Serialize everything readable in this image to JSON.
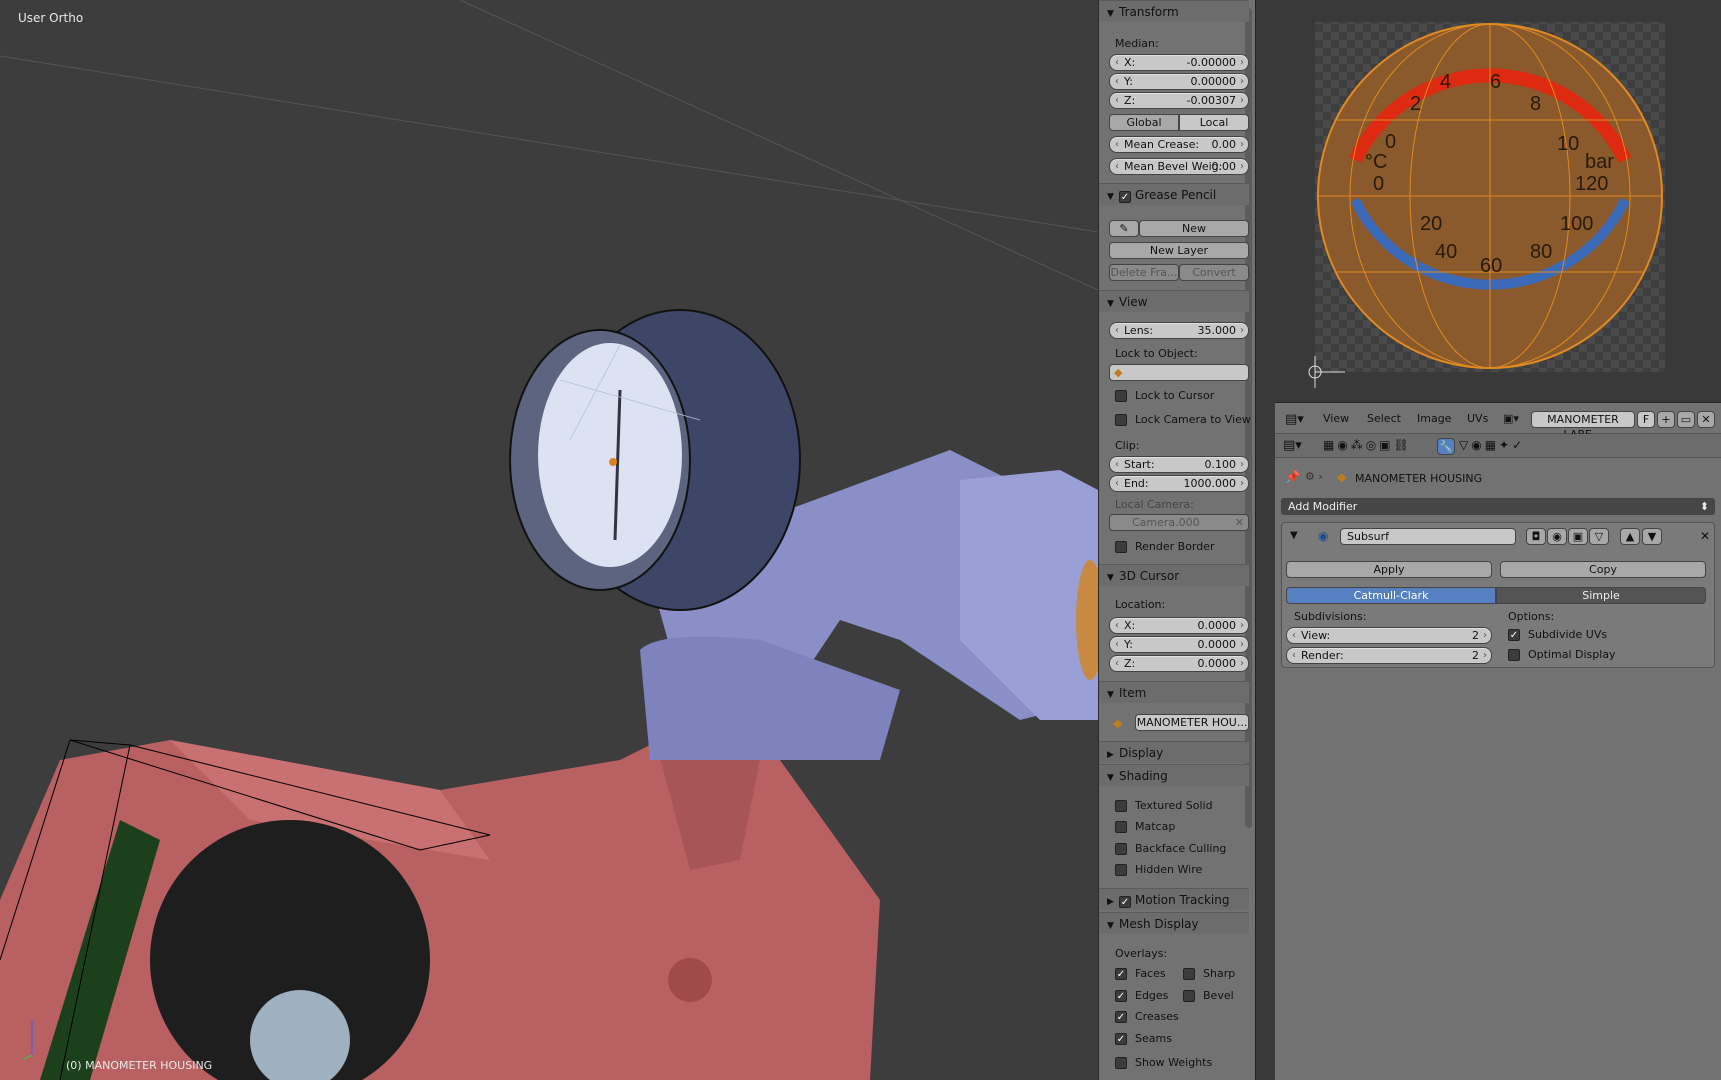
{
  "viewport": {
    "view_label": "User Ortho",
    "object_label": "(0) MANOMETER HOUSING"
  },
  "npanel": {
    "transform": {
      "title": "Transform",
      "median_label": "Median:",
      "x_label": "X:",
      "x_value": "-0.00000",
      "y_label": "Y:",
      "y_value": "0.00000",
      "z_label": "Z:",
      "z_value": "-0.00307",
      "global_label": "Global",
      "local_label": "Local",
      "mean_crease_label": "Mean Crease:",
      "mean_crease_value": "0.00",
      "mean_bevel_label": "Mean Bevel Weig:",
      "mean_bevel_value": "0.00"
    },
    "grease_pencil": {
      "title": "Grease Pencil",
      "new_label": "New",
      "new_layer_label": "New Layer",
      "delete_frame_label": "Delete Fra...",
      "convert_label": "Convert"
    },
    "view": {
      "title": "View",
      "lens_label": "Lens:",
      "lens_value": "35.000",
      "lock_to_object_label": "Lock to Object:",
      "lock_to_cursor_label": "Lock to Cursor",
      "lock_camera_label": "Lock Camera to View",
      "clip_label": "Clip:",
      "start_label": "Start:",
      "start_value": "0.100",
      "end_label": "End:",
      "end_value": "1000.000",
      "local_camera_label": "Local Camera:",
      "camera_value": "Camera.000",
      "render_border_label": "Render Border"
    },
    "cursor": {
      "title": "3D Cursor",
      "location_label": "Location:",
      "x_label": "X:",
      "x_value": "0.0000",
      "y_label": "Y:",
      "y_value": "0.0000",
      "z_label": "Z:",
      "z_value": "0.0000"
    },
    "item": {
      "title": "Item",
      "name": "MANOMETER HOU..."
    },
    "display": {
      "title": "Display"
    },
    "shading": {
      "title": "Shading",
      "textured_solid": "Textured Solid",
      "matcap": "Matcap",
      "backface_culling": "Backface Culling",
      "hidden_wire": "Hidden Wire"
    },
    "motion_tracking": {
      "title": "Motion Tracking"
    },
    "mesh_display": {
      "title": "Mesh Display",
      "overlays_label": "Overlays:",
      "faces": "Faces",
      "sharp": "Sharp",
      "edges": "Edges",
      "bevel": "Bevel",
      "creases": "Creases",
      "seams": "Seams",
      "show_weights": "Show Weights"
    }
  },
  "uv_editor": {
    "gauge_numbers": [
      "0",
      "2",
      "4",
      "6",
      "8",
      "10",
      "°C",
      "bar",
      "0",
      "20",
      "40",
      "60",
      "80",
      "100",
      "120"
    ],
    "header": {
      "view": "View",
      "select": "Select",
      "image": "Image",
      "uvs": "UVs",
      "image_name": "MANOMETER LABE...",
      "f_label": "F"
    }
  },
  "properties": {
    "object_name": "MANOMETER HOUSING",
    "add_modifier_label": "Add Modifier",
    "modifier": {
      "name": "Subsurf",
      "apply_label": "Apply",
      "copy_label": "Copy",
      "catmull_label": "Catmull-Clark",
      "simple_label": "Simple",
      "subdivisions_label": "Subdivisions:",
      "options_label": "Options:",
      "view_label": "View:",
      "view_value": "2",
      "render_label": "Render:",
      "render_value": "2",
      "subdivide_uvs_label": "Subdivide UVs",
      "optimal_display_label": "Optimal Display"
    }
  }
}
